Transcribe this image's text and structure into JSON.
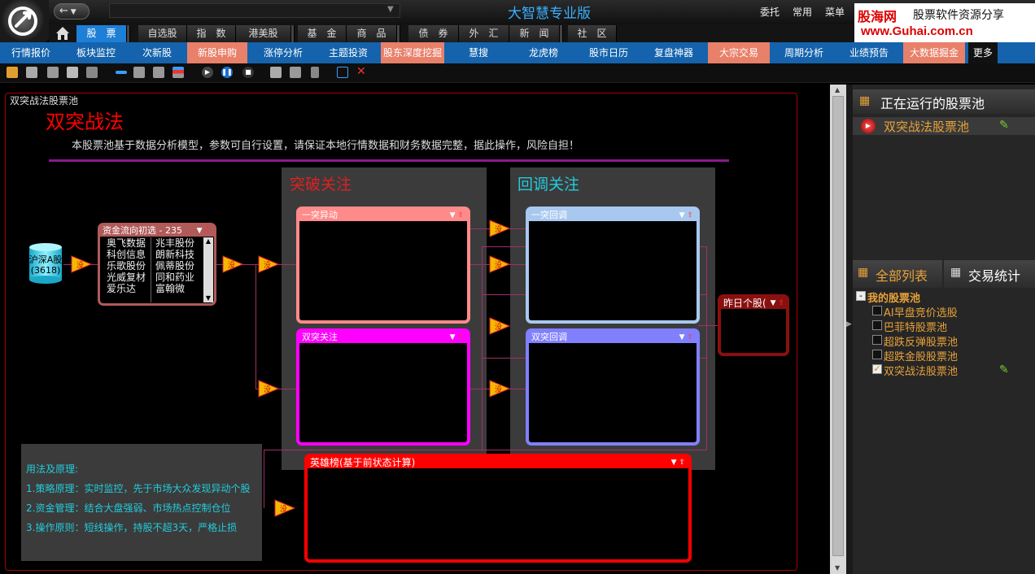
{
  "app": {
    "title": "大智慧专业版",
    "menu": [
      "委托",
      "常用",
      "菜单"
    ]
  },
  "brand": {
    "line1": "股海网",
    "line2": "股票软件资源分享",
    "line3": "www.Guhai.com.cn"
  },
  "nav_tabs": [
    "股　票",
    "自选股",
    "指　数",
    "港美股",
    "基　金",
    "商　品",
    "债　券",
    "外　汇",
    "新　闻",
    "社　区"
  ],
  "sub_tabs": [
    "行情报价",
    "板块监控",
    "次新股",
    "新股申购",
    "涨停分析",
    "主题投资",
    "股东深度挖掘",
    "慧搜",
    "龙虎榜",
    "股市日历",
    "复盘神器",
    "大宗交易",
    "周期分析",
    "业绩预告",
    "大数据掘金",
    "更多"
  ],
  "pool": {
    "label": "双突战法股票池",
    "title": "双突战法",
    "description": "本股票池基于数据分析模型，参数可自行设置，请保证本地行情数据和财务数据完整，据此操作，风险自担！",
    "source": {
      "line1": "沪深A股",
      "line2": "(3618)"
    },
    "fund_box": {
      "header": "资金流向初选 - 235",
      "col1": [
        "奥飞数据",
        "科创信息",
        "乐歌股份",
        "光威复材",
        "爱乐达"
      ],
      "col2": [
        "兆丰股份",
        "朗新科技",
        "佩蒂股份",
        "同和药业",
        "富翰微"
      ]
    },
    "switch_label": "没",
    "breakout_zone": "突破关注",
    "pullback_zone": "回调关注",
    "boxes": {
      "yitu_yidong": "一突异动",
      "shuangtu_guanzhu": "双突关注",
      "yitu_huitiao": "一突回调",
      "shuangtu_huitiao": "双突回调",
      "zuori": "昨日个股(",
      "hero": "英雄榜(基于前状态计算)"
    },
    "usage": {
      "title": "用法及原理:",
      "items": [
        "1.策略原理：实时监控，先于市场大众发现异动个股",
        "2.资金管理：结合大盘强弱、市场热点控制仓位",
        "3.操作原则：短线操作，持股不超3天，严格止损"
      ]
    }
  },
  "right_panel": {
    "running_title": "正在运行的股票池",
    "running_item": "双突战法股票池",
    "tab_all": "全部列表",
    "tab_stats": "交易统计",
    "tree_root": "我的股票池",
    "tree_items": [
      {
        "label": "AI早盘竞价选股",
        "checked": false
      },
      {
        "label": "巴菲特股票池",
        "checked": false
      },
      {
        "label": "超跌反弹股票池",
        "checked": false
      },
      {
        "label": "超跌金股股票池",
        "checked": false
      },
      {
        "label": "双突战法股票池",
        "checked": true
      }
    ]
  },
  "colors": {
    "accent_blue": "#1463ac",
    "tab_orange": "#e8806a",
    "title_red": "#ff0000",
    "zone_cyan": "#22ccdd"
  }
}
